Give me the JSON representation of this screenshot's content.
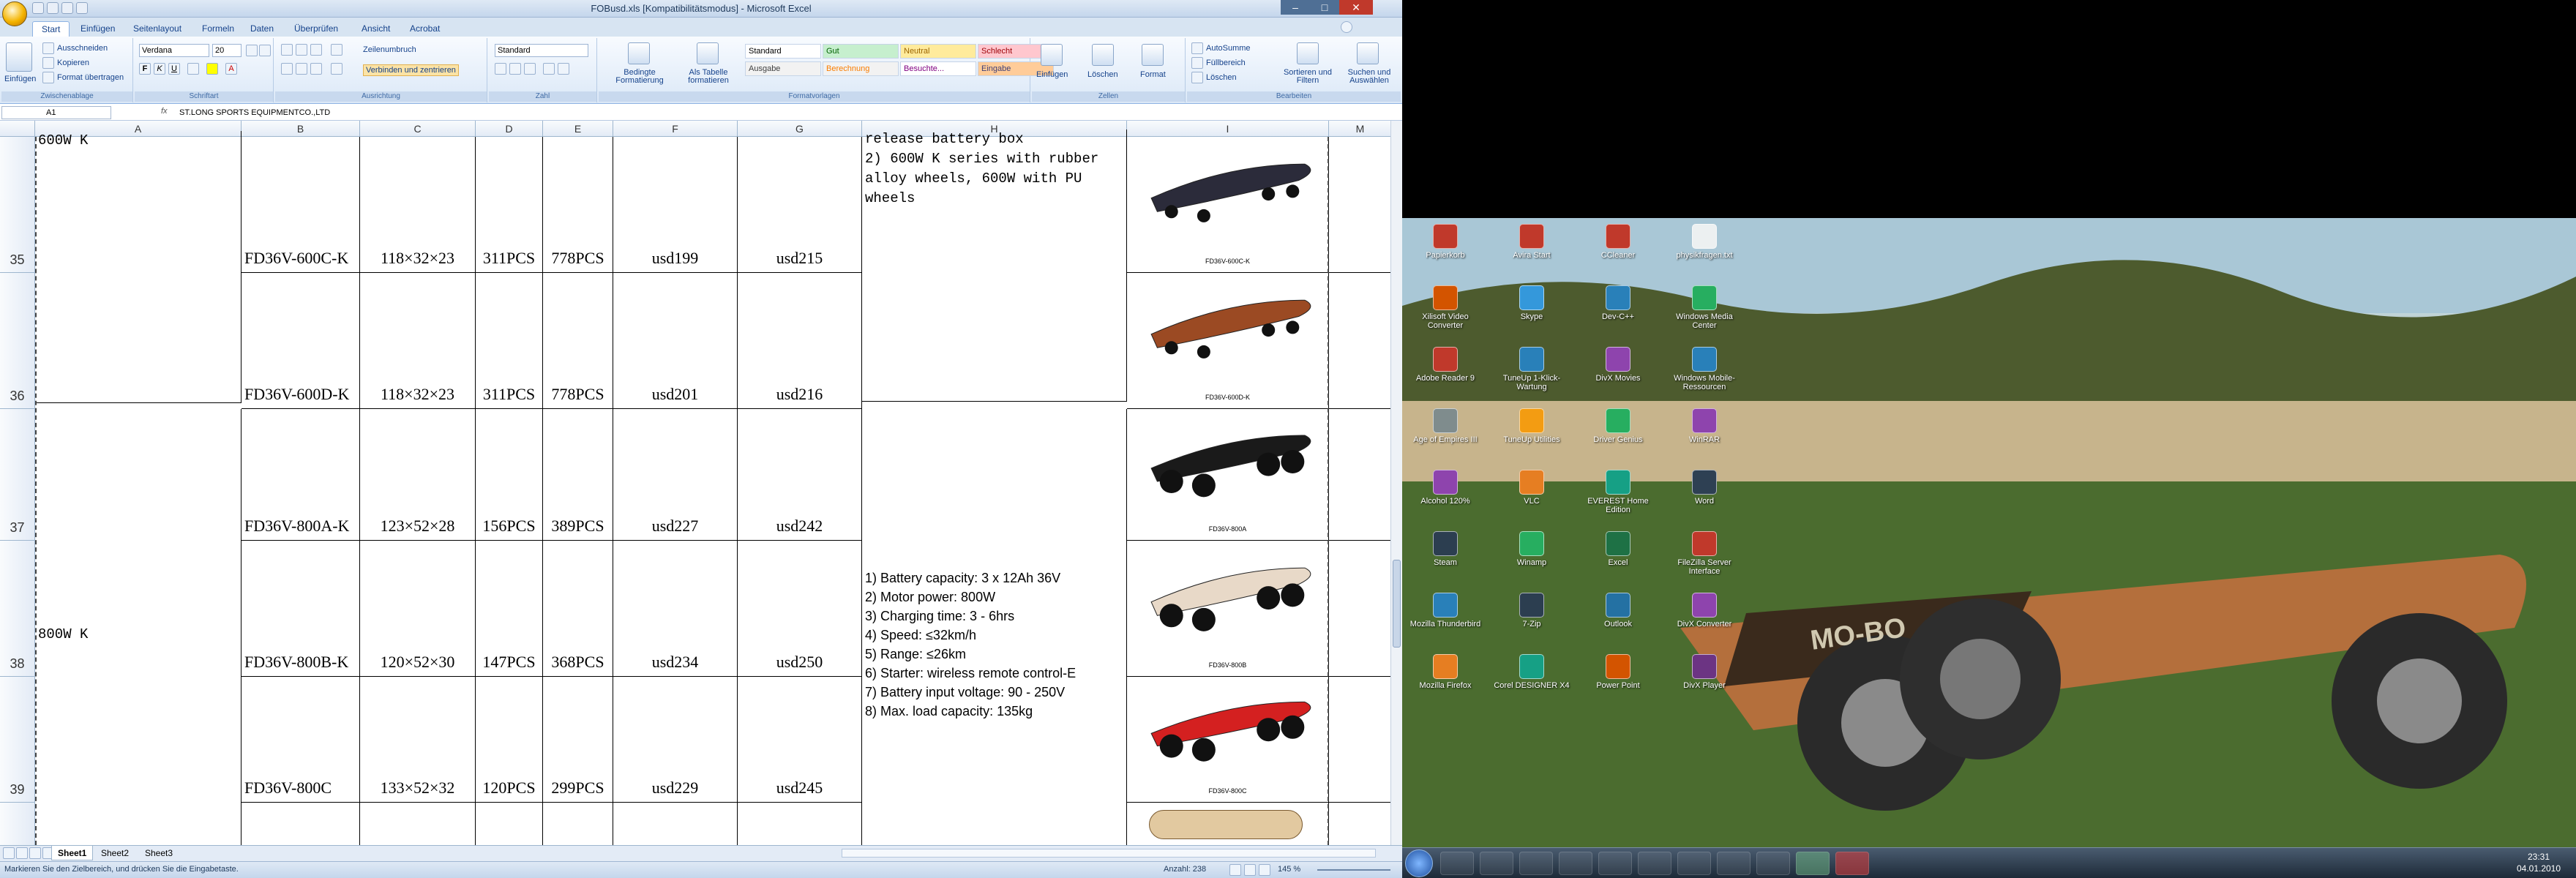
{
  "window": {
    "title": "FOBusd.xls [Kompatibilitätsmodus] - Microsoft Excel",
    "tabs": [
      "Start",
      "Einfügen",
      "Seitenlayout",
      "Formeln",
      "Daten",
      "Überprüfen",
      "Ansicht",
      "Acrobat"
    ]
  },
  "ribbon": {
    "clipboard": {
      "paste": "Einfügen",
      "cut": "Ausschneiden",
      "copy": "Kopieren",
      "format_painter": "Format übertragen",
      "label": "Zwischenablage"
    },
    "font": {
      "name": "Verdana",
      "size": "20",
      "label": "Schriftart"
    },
    "alignment": {
      "wrap": "Zeilenumbruch",
      "merge": "Verbinden und zentrieren",
      "label": "Ausrichtung"
    },
    "number": {
      "format": "Standard",
      "label": "Zahl"
    },
    "styles": {
      "conditional": "Bedingte Formatierung",
      "as_table": "Als Tabelle formatieren",
      "items": [
        {
          "label": "Standard",
          "bg": "#ffffff",
          "fg": "#000000"
        },
        {
          "label": "Gut",
          "bg": "#c6efce",
          "fg": "#006100"
        },
        {
          "label": "Neutral",
          "bg": "#ffeb9c",
          "fg": "#9c6500"
        },
        {
          "label": "Schlecht",
          "bg": "#ffc7ce",
          "fg": "#9c0006"
        },
        {
          "label": "Ausgabe",
          "bg": "#f2f2f2",
          "fg": "#3f3f3f"
        },
        {
          "label": "Berechnung",
          "bg": "#f2f2f2",
          "fg": "#fa7d00"
        },
        {
          "label": "Besuchte...",
          "bg": "#ffffff",
          "fg": "#800080"
        },
        {
          "label": "Eingabe",
          "bg": "#ffcc99",
          "fg": "#3f3f76"
        }
      ],
      "label": "Formatvorlagen"
    },
    "cells": {
      "insert": "Einfügen",
      "delete": "Löschen",
      "format": "Format",
      "label": "Zellen"
    },
    "editing": {
      "autosum": "AutoSumme",
      "fill": "Füllbereich",
      "clear": "Löschen",
      "sort": "Sortieren und Filtern",
      "find": "Suchen und Auswählen",
      "label": "Bearbeiten"
    }
  },
  "formula_bar": {
    "cell": "A1",
    "fx": "fx",
    "value": "ST.LONG SPORTS EQUIPMENTCO.,LTD"
  },
  "columns": [
    "A",
    "B",
    "C",
    "D",
    "E",
    "F",
    "G",
    "H",
    "I",
    "M"
  ],
  "rows": [
    {
      "num": "35",
      "model": "FD36V-600C-K",
      "size": "118×32×23",
      "qty1": "311PCS",
      "qty2": "778PCS",
      "p1": "usd199",
      "p2": "usd215",
      "img": "FD36V-600C-K"
    },
    {
      "num": "36",
      "model": "FD36V-600D-K",
      "size": "118×32×23",
      "qty1": "311PCS",
      "qty2": "778PCS",
      "p1": "usd201",
      "p2": "usd216",
      "img": "FD36V-600D-K"
    },
    {
      "num": "37",
      "model": "FD36V-800A-K",
      "size": "123×52×28",
      "qty1": "156PCS",
      "qty2": "389PCS",
      "p1": "usd227",
      "p2": "usd242",
      "img": "FD36V-800A"
    },
    {
      "num": "38",
      "model": "FD36V-800B-K",
      "size": "120×52×30",
      "qty1": "147PCS",
      "qty2": "368PCS",
      "p1": "usd234",
      "p2": "usd250",
      "img": "FD36V-800B"
    },
    {
      "num": "39",
      "model": "FD36V-800C",
      "size": "133×52×32",
      "qty1": "120PCS",
      "qty2": "299PCS",
      "p1": "usd229",
      "p2": "usd245",
      "img": "FD36V-800C"
    }
  ],
  "groups": {
    "a600": "600W K",
    "a800": "800W K",
    "h600": "release battery box\n2) 600W K series with rubber\nalloy wheels, 600W with PU\nwheels",
    "h800": "1) Battery capacity: 3 x 12Ah 36V\n2) Motor power: 800W\n3) Charging time: 3 - 6hrs\n4) Speed: ≤32km/h\n5) Range: ≤26km\n6) Starter: wireless remote control-E\n7) Battery input voltage: 90 - 250V\n8) Max. load capacity: 135kg"
  },
  "sheets": [
    "Sheet1",
    "Sheet2",
    "Sheet3"
  ],
  "status": {
    "message": "Markieren Sie den Zielbereich, und drücken Sie die Eingabetaste.",
    "count": "Anzahl: 238",
    "zoom": "145 %"
  },
  "desktop": {
    "icons": [
      {
        "label": "Papierkorb",
        "color": "#c0392b"
      },
      {
        "label": "Xilisoft Video Converter",
        "color": "#d35400"
      },
      {
        "label": "Adobe Reader 9",
        "color": "#c0392b"
      },
      {
        "label": "Age of Empires III",
        "color": "#7f8c8d"
      },
      {
        "label": "Alcohol 120%",
        "color": "#8e44ad"
      },
      {
        "label": "Steam",
        "color": "#2c3e50"
      },
      {
        "label": "Mozilla Thunderbird",
        "color": "#2980b9"
      },
      {
        "label": "Mozilla Firefox",
        "color": "#e67e22"
      },
      {
        "label": "Avira Start",
        "color": "#c0392b"
      },
      {
        "label": "Skype",
        "color": "#3498db"
      },
      {
        "label": "TuneUp 1-Klick-Wartung",
        "color": "#2980b9"
      },
      {
        "label": "TuneUp Utilities",
        "color": "#f39c12"
      },
      {
        "label": "VLC",
        "color": "#e67e22"
      },
      {
        "label": "Winamp",
        "color": "#27ae60"
      },
      {
        "label": "7-Zip",
        "color": "#2c3e50"
      },
      {
        "label": "Corel DESIGNER X4",
        "color": "#16a085"
      },
      {
        "label": "CCleaner",
        "color": "#c0392b"
      },
      {
        "label": "Dev-C++",
        "color": "#2980b9"
      },
      {
        "label": "DivX Movies",
        "color": "#8e44ad"
      },
      {
        "label": "Driver Genius",
        "color": "#27ae60"
      },
      {
        "label": "EVEREST Home Edition",
        "color": "#16a085"
      },
      {
        "label": "Excel",
        "color": "#1e7145"
      },
      {
        "label": "Outlook",
        "color": "#2471a3"
      },
      {
        "label": "Power Point",
        "color": "#d35400"
      },
      {
        "label": "physikfragen.txt",
        "color": "#ecf0f1"
      },
      {
        "label": "Windows Media Center",
        "color": "#27ae60"
      },
      {
        "label": "Windows Mobile-Ressourcen",
        "color": "#2980b9"
      },
      {
        "label": "WinRAR",
        "color": "#8e44ad"
      },
      {
        "label": "Word",
        "color": "#2e4053"
      },
      {
        "label": "FileZilla Server Interface",
        "color": "#c0392b"
      },
      {
        "label": "DivX Converter",
        "color": "#8e44ad"
      },
      {
        "label": "DivX Player",
        "color": "#6c3483"
      }
    ],
    "clock": {
      "time": "23:31",
      "date": "04.01.2010"
    }
  }
}
